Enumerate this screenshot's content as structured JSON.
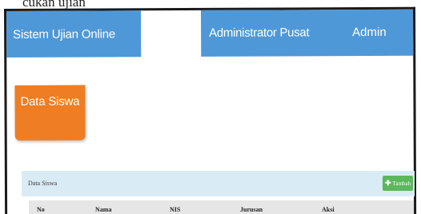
{
  "caption": {
    "text": "cukan ujian"
  },
  "header": {
    "app_title": "Sistem Ujian Online",
    "role_label": "Administrator Pusat",
    "user_label": "Admin"
  },
  "tile": {
    "label": "Data Siswa"
  },
  "panel": {
    "title": "Data Siswa",
    "add_button": {
      "icon": "plus-icon",
      "label": "Tambah"
    }
  },
  "table": {
    "columns": [
      "No",
      "Nama",
      "NIS",
      "Jurusan",
      "Aksi"
    ]
  },
  "colors": {
    "header_blue": "#4f98d7",
    "tile_orange": "#ee7d24",
    "panel_head": "#d9ecf5",
    "success_green": "#5cb85c"
  }
}
